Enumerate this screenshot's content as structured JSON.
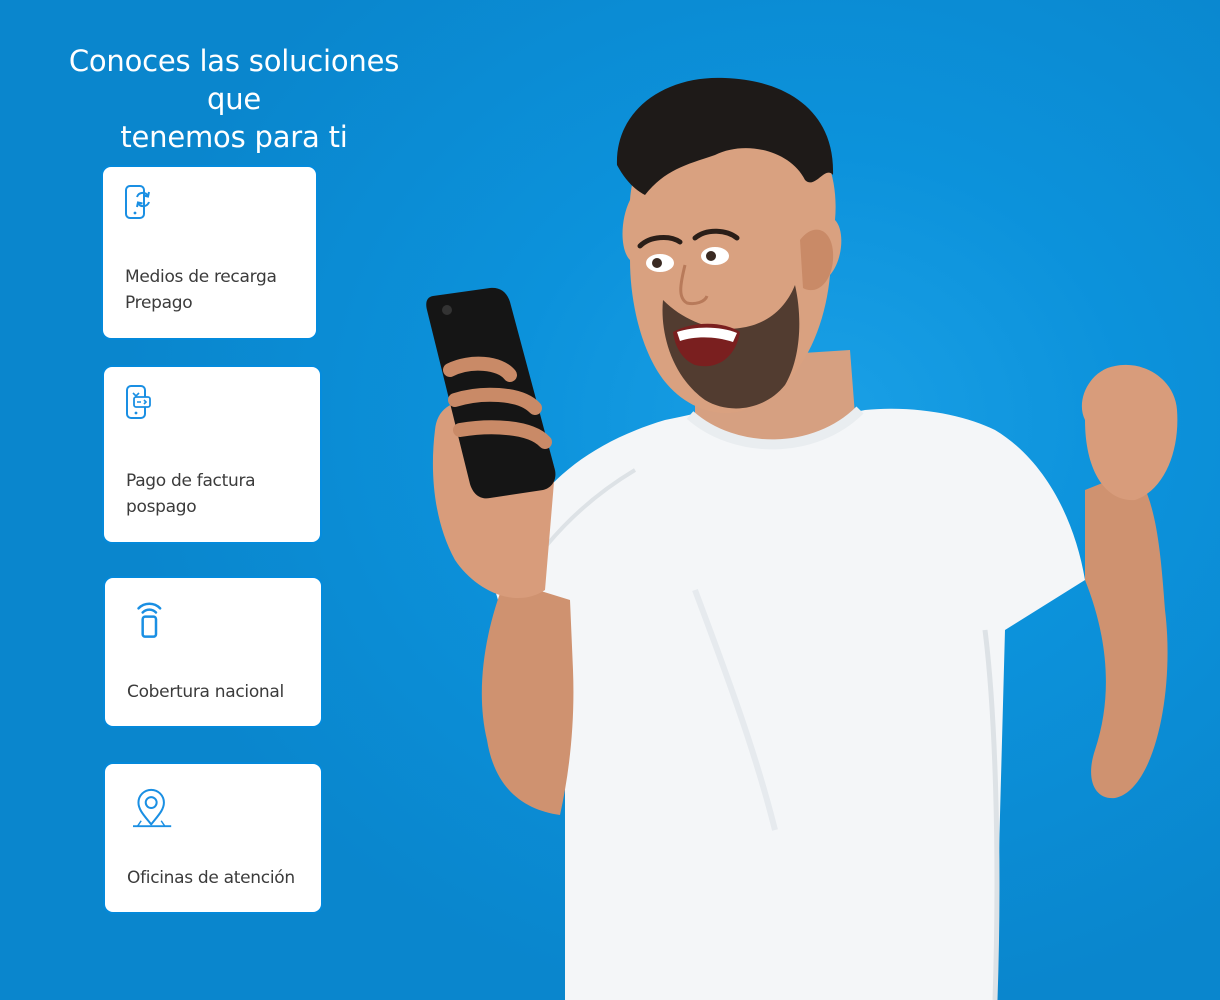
{
  "headline": {
    "line1": "Conoces las soluciones que",
    "line2": "tenemos para ti"
  },
  "cards": [
    {
      "icon": "phone-refresh-icon",
      "label_line1": "Medios de recarga",
      "label_line2": "Prepago"
    },
    {
      "icon": "phone-payment-icon",
      "label_line1": "Pago de factura",
      "label_line2": "pospago"
    },
    {
      "icon": "phone-signal-icon",
      "label_line1": "Cobertura nacional"
    },
    {
      "icon": "location-pin-icon",
      "label_line1": "Oficinas de atención"
    }
  ],
  "colors": {
    "background": "#0a8fd8",
    "card_background": "#ffffff",
    "icon_blue": "#1a8fe3",
    "text_dark": "#3b3b3b"
  }
}
